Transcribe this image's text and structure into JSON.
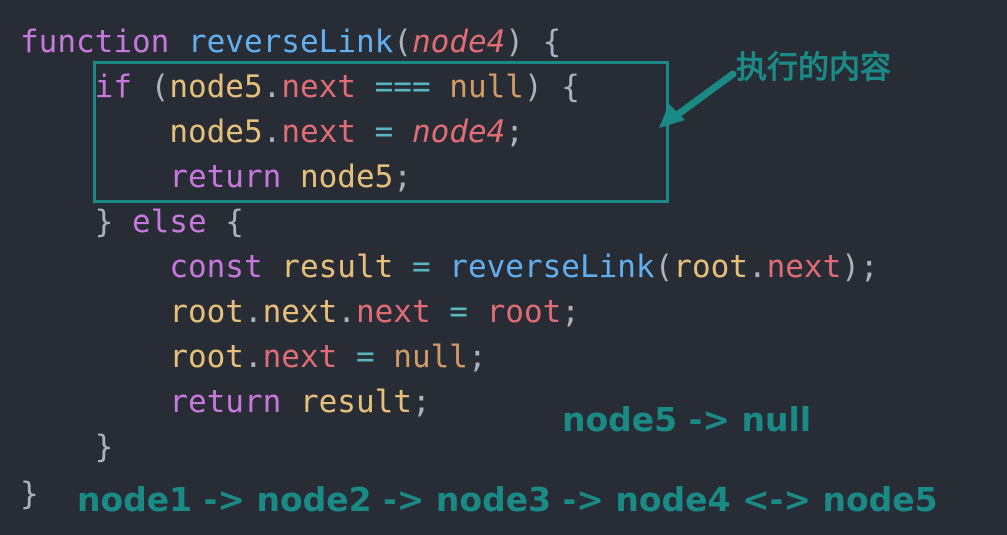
{
  "code": {
    "line1": {
      "kw": "function",
      "fn": "reverseLink",
      "open": "(",
      "param": "node4",
      "close": ") {"
    },
    "line2": {
      "kw": "if",
      "open": " (",
      "var": "node5",
      "dot": ".",
      "prop": "next",
      "op": " === ",
      "lit": "null",
      "close": ") {"
    },
    "line3": {
      "var": "node5",
      "dot": ".",
      "prop": "next",
      "op": " = ",
      "param": "node4",
      "semi": ";"
    },
    "line4": {
      "kw": "return",
      "var": " node5",
      "semi": ";"
    },
    "line5": {
      "brace": "} ",
      "kw": "else",
      "open": " {"
    },
    "line6": {
      "kw": "const",
      "var": " result",
      "op": " = ",
      "fn": "reverseLink",
      "open": "(",
      "var2": "root",
      "dot": ".",
      "prop": "next",
      "close": ");"
    },
    "line7": {
      "var": "root",
      "dot": ".",
      "var2": "next",
      "dot2": ".",
      "prop": "next",
      "op": " = ",
      "prop2": "root",
      "semi": ";"
    },
    "line8": {
      "var": "root",
      "dot": ".",
      "prop": "next",
      "op": " = ",
      "lit": "null",
      "semi": ";"
    },
    "line9": {
      "kw": "return",
      "var": " result",
      "semi": ";"
    },
    "line10": {
      "brace": "}"
    },
    "line11": {
      "brace": "}"
    }
  },
  "annotations": {
    "executed": "执行的内容",
    "node5_state": "node5 -> null",
    "chain": "node1 -> node2 -> node3 -> node4 <-> node5"
  },
  "colors": {
    "background": "#282c34",
    "annotation": "#1a8a86"
  }
}
